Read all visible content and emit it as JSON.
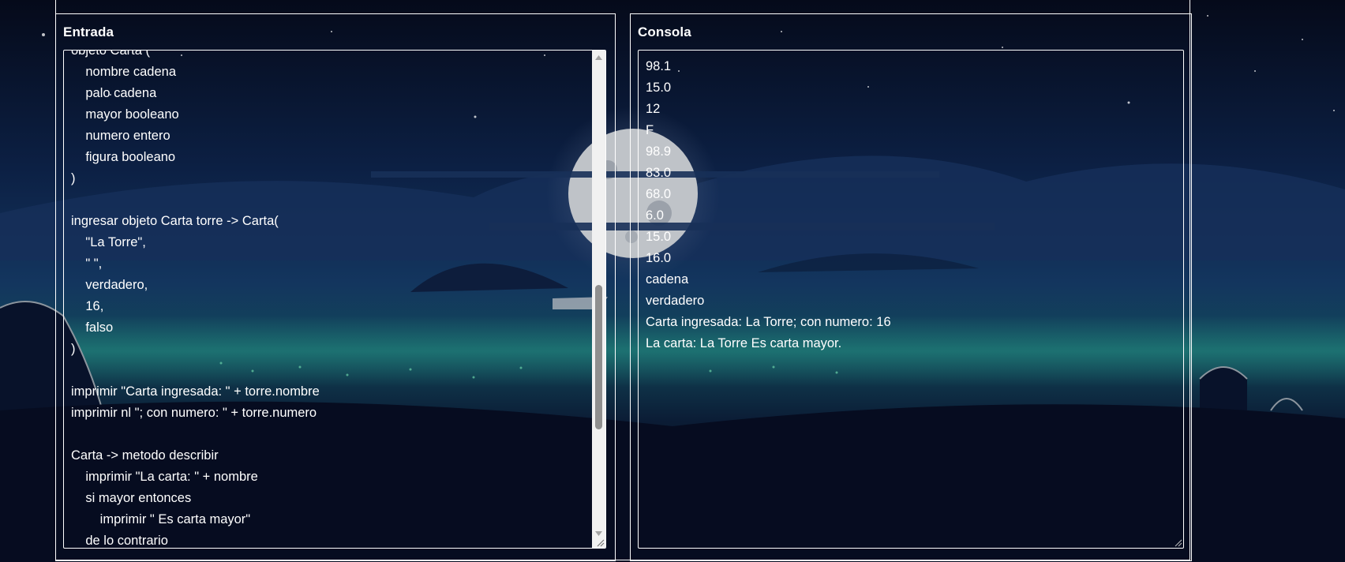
{
  "colors": {
    "sky_top": "#060b1c",
    "sky_mid": "#0f2a52",
    "horizon_glow": "#1d7a7a",
    "moon": "#bfc3c8",
    "panel_border": "#ffffff",
    "text": "#ffffff",
    "scrollbar_track": "#f1f1f1",
    "scrollbar_thumb": "#8f8f8f"
  },
  "input_panel": {
    "title": "Entrada",
    "code": "objeto Carta (\n\tnombre cadena\n\tpalo cadena\n\tmayor booleano\n\tnumero entero\n\tfigura booleano\n)\n\ningresar objeto Carta torre -> Carta(\n\t\"La Torre\",\n\t\" \",\n\tverdadero,\n\t16,\n    falso\n)\n\nimprimir \"Carta ingresada: \" + torre.nombre\nimprimir nl \"; con numero: \" + torre.numero\n\nCarta -> metodo describir\n    imprimir \"La carta: \" + nombre\n    si mayor entonces\n        imprimir \" Es carta mayor\"\n    de lo contrario",
    "icons": {
      "scroll_up": "arrow-up-icon",
      "scroll_down": "arrow-down-icon",
      "resize": "resize-grip-icon"
    }
  },
  "output_panel": {
    "title": "Consola",
    "lines": [
      "98.1",
      "15.0",
      "12",
      "F",
      "98.9",
      "83.0",
      "68.0",
      "6.0",
      "15.0",
      "16.0",
      "cadena",
      "verdadero",
      "Carta ingresada: La Torre; con numero: 16",
      "La carta: La Torre Es carta mayor."
    ],
    "icons": {
      "resize": "resize-grip-icon"
    }
  }
}
